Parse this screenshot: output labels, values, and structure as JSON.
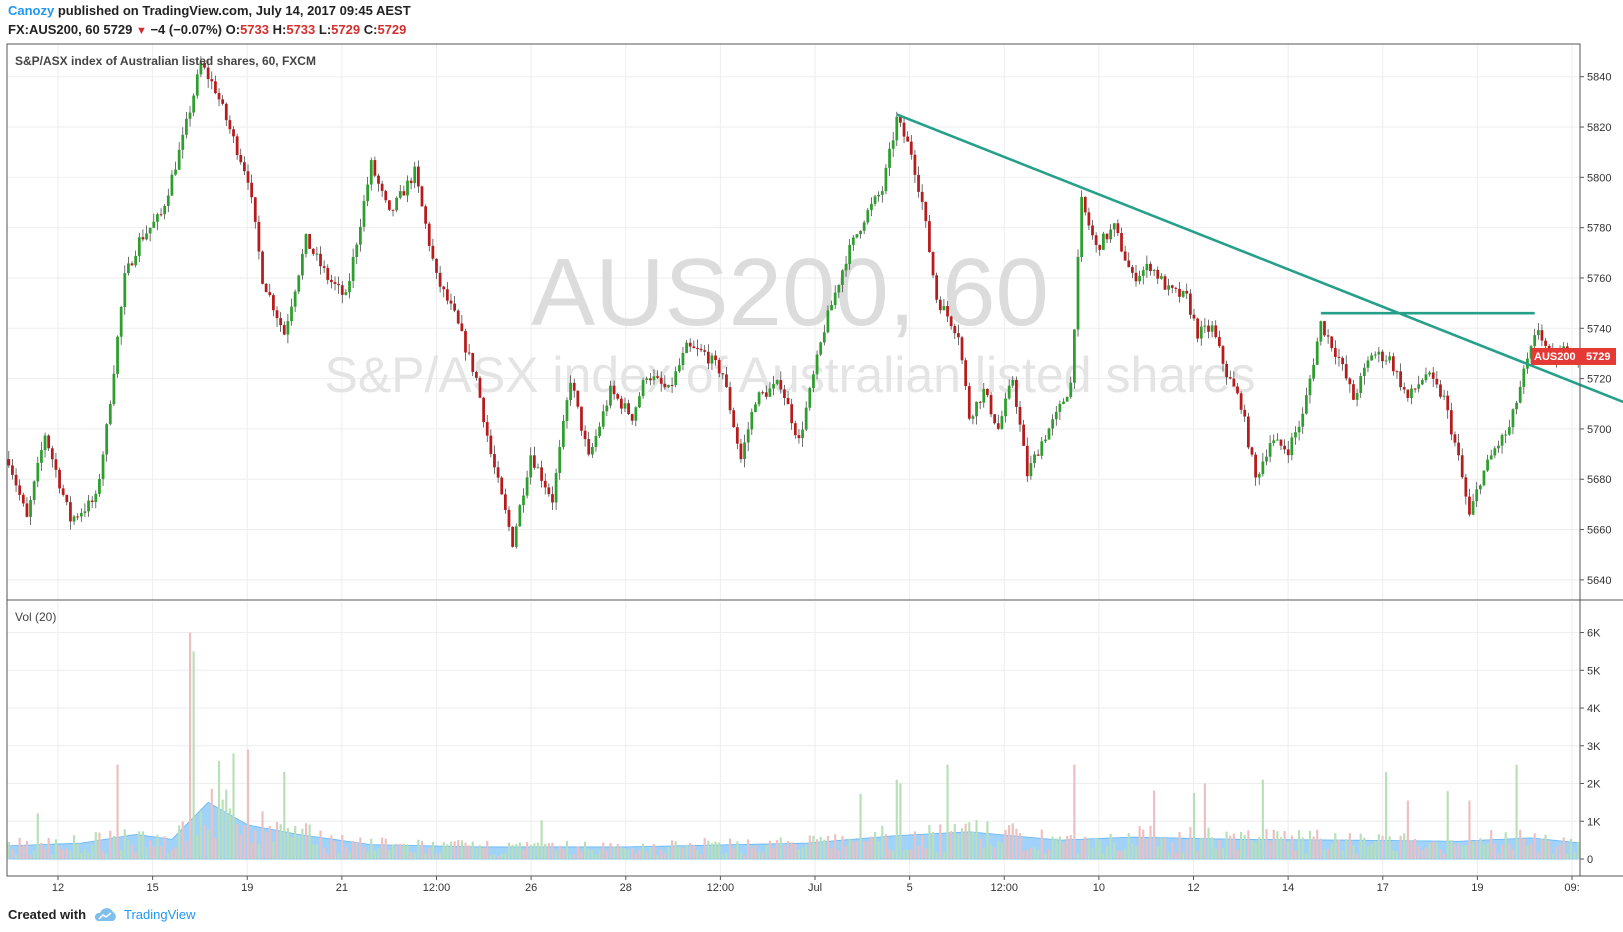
{
  "header": {
    "author": "Canozy",
    "published_text": "published on TradingView.com, July 14, 2017 09:45 AEST",
    "symbol": "FX:AUS200, 60",
    "last": "5729",
    "change": "−4 (−0.07%)",
    "o_label": "O:",
    "o": "5733",
    "h_label": "H:",
    "h": "5733",
    "l_label": "L:",
    "l": "5729",
    "c_label": "C:",
    "c": "5729"
  },
  "price_label": {
    "symbol": "AUS200",
    "value": "5729"
  },
  "watermark": {
    "line1": "AUS200, 60",
    "line2": "S&P/ASX index of Australian listed shares"
  },
  "footer": {
    "created_with": "Created with",
    "brand": "TradingView"
  },
  "colors": {
    "up": "#2e9e2e",
    "down": "#b71c1c",
    "trend": "#26a08a",
    "vol_ma": "#90caf9",
    "label_bg": "#e53935"
  },
  "chart_data": [
    {
      "type": "candlestick",
      "title": "S&P/ASX index of Australian listed shares, 60, FXCM",
      "ylim": [
        5632,
        5853
      ],
      "y_ticks": [
        5640,
        5660,
        5680,
        5700,
        5720,
        5740,
        5760,
        5780,
        5800,
        5820,
        5840
      ],
      "x_ticks": [
        "12",
        "15",
        "19",
        "21",
        "12:00",
        "26",
        "28",
        "12:00",
        "Jul",
        "5",
        "12:00",
        "10",
        "12",
        "14",
        "17",
        "19",
        "09:"
      ],
      "grid": true,
      "path": [
        {
          "t": 0,
          "p": 5688
        },
        {
          "t": 5,
          "p": 5664
        },
        {
          "t": 10,
          "p": 5698
        },
        {
          "t": 17,
          "p": 5664
        },
        {
          "t": 24,
          "p": 5672
        },
        {
          "t": 27,
          "p": 5700
        },
        {
          "t": 32,
          "p": 5760
        },
        {
          "t": 36,
          "p": 5775
        },
        {
          "t": 42,
          "p": 5785
        },
        {
          "t": 48,
          "p": 5815
        },
        {
          "t": 53,
          "p": 5845
        },
        {
          "t": 57,
          "p": 5835
        },
        {
          "t": 62,
          "p": 5815
        },
        {
          "t": 66,
          "p": 5800
        },
        {
          "t": 70,
          "p": 5760
        },
        {
          "t": 76,
          "p": 5738
        },
        {
          "t": 82,
          "p": 5775
        },
        {
          "t": 88,
          "p": 5760
        },
        {
          "t": 93,
          "p": 5752
        },
        {
          "t": 100,
          "p": 5805
        },
        {
          "t": 105,
          "p": 5785
        },
        {
          "t": 112,
          "p": 5802
        },
        {
          "t": 118,
          "p": 5760
        },
        {
          "t": 123,
          "p": 5745
        },
        {
          "t": 129,
          "p": 5720
        },
        {
          "t": 133,
          "p": 5690
        },
        {
          "t": 139,
          "p": 5655
        },
        {
          "t": 144,
          "p": 5690
        },
        {
          "t": 150,
          "p": 5672
        },
        {
          "t": 155,
          "p": 5720
        },
        {
          "t": 160,
          "p": 5688
        },
        {
          "t": 166,
          "p": 5715
        },
        {
          "t": 172,
          "p": 5705
        },
        {
          "t": 176,
          "p": 5722
        },
        {
          "t": 182,
          "p": 5715
        },
        {
          "t": 187,
          "p": 5732
        },
        {
          "t": 192,
          "p": 5730
        },
        {
          "t": 197,
          "p": 5722
        },
        {
          "t": 202,
          "p": 5688
        },
        {
          "t": 206,
          "p": 5712
        },
        {
          "t": 213,
          "p": 5718
        },
        {
          "t": 218,
          "p": 5695
        },
        {
          "t": 225,
          "p": 5740
        },
        {
          "t": 231,
          "p": 5768
        },
        {
          "t": 236,
          "p": 5784
        },
        {
          "t": 241,
          "p": 5795
        },
        {
          "t": 245,
          "p": 5823
        },
        {
          "t": 249,
          "p": 5810
        },
        {
          "t": 252,
          "p": 5790
        },
        {
          "t": 256,
          "p": 5752
        },
        {
          "t": 262,
          "p": 5738
        },
        {
          "t": 265,
          "p": 5705
        },
        {
          "t": 269,
          "p": 5715
        },
        {
          "t": 273,
          "p": 5700
        },
        {
          "t": 277,
          "p": 5720
        },
        {
          "t": 281,
          "p": 5682
        },
        {
          "t": 285,
          "p": 5695
        },
        {
          "t": 289,
          "p": 5705
        },
        {
          "t": 293,
          "p": 5718
        },
        {
          "t": 296,
          "p": 5790
        },
        {
          "t": 300,
          "p": 5772
        },
        {
          "t": 305,
          "p": 5780
        },
        {
          "t": 310,
          "p": 5760
        },
        {
          "t": 315,
          "p": 5765
        },
        {
          "t": 320,
          "p": 5755
        },
        {
          "t": 325,
          "p": 5752
        },
        {
          "t": 328,
          "p": 5738
        },
        {
          "t": 332,
          "p": 5740
        },
        {
          "t": 336,
          "p": 5722
        },
        {
          "t": 340,
          "p": 5710
        },
        {
          "t": 344,
          "p": 5680
        },
        {
          "t": 348,
          "p": 5695
        },
        {
          "t": 353,
          "p": 5692
        },
        {
          "t": 357,
          "p": 5705
        },
        {
          "t": 362,
          "p": 5742
        },
        {
          "t": 367,
          "p": 5728
        },
        {
          "t": 371,
          "p": 5712
        },
        {
          "t": 376,
          "p": 5730
        },
        {
          "t": 381,
          "p": 5728
        },
        {
          "t": 386,
          "p": 5712
        },
        {
          "t": 391,
          "p": 5722
        },
        {
          "t": 396,
          "p": 5712
        },
        {
          "t": 400,
          "p": 5688
        },
        {
          "t": 403,
          "p": 5665
        },
        {
          "t": 406,
          "p": 5680
        },
        {
          "t": 410,
          "p": 5692
        },
        {
          "t": 414,
          "p": 5700
        },
        {
          "t": 418,
          "p": 5722
        },
        {
          "t": 422,
          "p": 5740
        },
        {
          "t": 426,
          "p": 5725
        },
        {
          "t": 430,
          "p": 5733
        },
        {
          "t": 433,
          "p": 5729
        }
      ],
      "trendlines": [
        {
          "x1": 245,
          "y1": 5825,
          "x2": 466,
          "y2": 5699
        },
        {
          "x1": 362,
          "y1": 5746,
          "x2": 421,
          "y2": 5746
        }
      ]
    },
    {
      "type": "bar",
      "title": "Vol (20)",
      "ylim": [
        0,
        6200
      ],
      "y_ticks": [
        "0",
        "1K",
        "2K",
        "3K",
        "4K",
        "5K",
        "6K"
      ],
      "y_tick_values": [
        0,
        1000,
        2000,
        3000,
        4000,
        5000,
        6000
      ],
      "volume_ma_profile": [
        {
          "t": 0,
          "v": 350
        },
        {
          "t": 20,
          "v": 420
        },
        {
          "t": 35,
          "v": 650
        },
        {
          "t": 45,
          "v": 520
        },
        {
          "t": 55,
          "v": 1500
        },
        {
          "t": 66,
          "v": 900
        },
        {
          "t": 80,
          "v": 650
        },
        {
          "t": 100,
          "v": 380
        },
        {
          "t": 130,
          "v": 320
        },
        {
          "t": 170,
          "v": 320
        },
        {
          "t": 220,
          "v": 420
        },
        {
          "t": 245,
          "v": 620
        },
        {
          "t": 265,
          "v": 720
        },
        {
          "t": 290,
          "v": 500
        },
        {
          "t": 310,
          "v": 580
        },
        {
          "t": 340,
          "v": 520
        },
        {
          "t": 370,
          "v": 500
        },
        {
          "t": 400,
          "v": 470
        },
        {
          "t": 420,
          "v": 560
        },
        {
          "t": 433,
          "v": 430
        }
      ],
      "spikes": [
        {
          "t": 50,
          "v": 6000
        },
        {
          "t": 51,
          "v": 5500
        },
        {
          "t": 62,
          "v": 2800
        },
        {
          "t": 66,
          "v": 2900
        },
        {
          "t": 30,
          "v": 2500
        },
        {
          "t": 58,
          "v": 2600
        },
        {
          "t": 245,
          "v": 2100
        },
        {
          "t": 259,
          "v": 2500
        },
        {
          "t": 294,
          "v": 2500
        },
        {
          "t": 330,
          "v": 2000
        },
        {
          "t": 346,
          "v": 2100
        },
        {
          "t": 380,
          "v": 2300
        },
        {
          "t": 397,
          "v": 1800
        },
        {
          "t": 416,
          "v": 2500
        }
      ]
    }
  ]
}
